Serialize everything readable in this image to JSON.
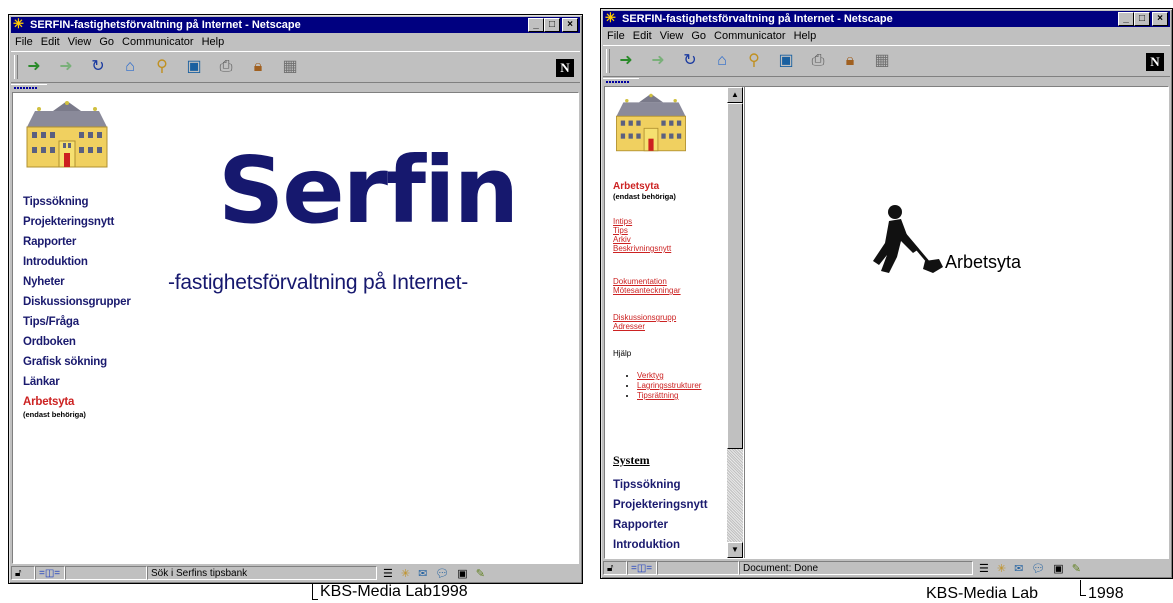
{
  "window_title": "SERFIN-fastighetsförvaltning på Internet - Netscape",
  "menu": [
    "File",
    "Edit",
    "View",
    "Go",
    "Communicator",
    "Help"
  ],
  "toolbar_icons": [
    "back-icon",
    "forward-icon",
    "reload-icon",
    "home-icon",
    "search-icon",
    "netscape-guide-icon",
    "print-icon",
    "security-icon",
    "stop-icon"
  ],
  "netscape_logo": "N",
  "left_window": {
    "nav": [
      "Tipssökning",
      "Projekteringsnytt",
      "Rapporter",
      "Introduktion",
      "Nyheter",
      "Diskussionsgrupper",
      "Tips/Fråga",
      "Ordboken",
      "Grafisk sökning",
      "Länkar"
    ],
    "workspace_link": "Arbetsyta",
    "workspace_note": "(endast behöriga)",
    "logo_title": "Serfin",
    "logo_subtitle": "-fastighetsförvaltning på Internet-",
    "status_text": "Sök i Serfins tipsbank"
  },
  "right_window": {
    "workspace_link": "Arbetsyta",
    "workspace_note": "(endast behöriga)",
    "links_group1": [
      "Intips",
      "Tips",
      "Arkiv",
      "Beskrivningsnytt"
    ],
    "links_group2": [
      "Dokumentation",
      "Mötesanteckningar"
    ],
    "links_group3": [
      "Diskussionsgrupp",
      "Adresser"
    ],
    "help_label": "Hjälp",
    "help_items": [
      "Verktyg",
      "Lagringsstrukturer",
      "Tipsrättning"
    ],
    "system_heading": "System",
    "system_nav": [
      "Tipssökning",
      "Projekteringsnytt",
      "Rapporter",
      "Introduktion"
    ],
    "workspace_label": "Arbetsyta",
    "status_text": "Document: Done"
  },
  "caption_left": "KBS-Media Lab1998",
  "caption_right_a": "KBS-Media Lab",
  "caption_right_b": "1998",
  "colors": {
    "titlebar": "#000080",
    "chrome": "#c0c0c0",
    "brand": "#16186e",
    "link_red": "#cc2222"
  }
}
